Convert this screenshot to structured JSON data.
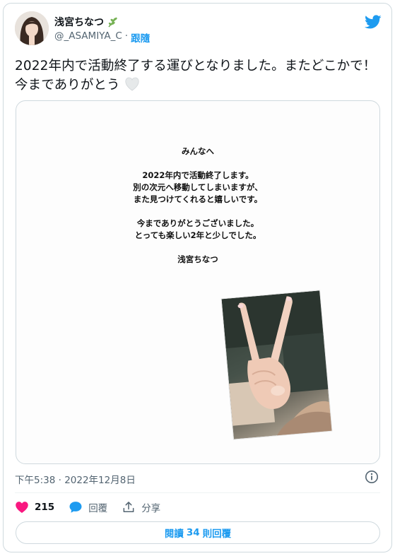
{
  "user": {
    "display_name": "浅宮ちなつ",
    "handle": "@_ASAMIYA_C",
    "separator": "·",
    "follow_label": "跟隨"
  },
  "tweet": {
    "text": "2022年内で活動終了する運びとなりました。またどこかで！今までありがとう",
    "emoji": "heart-icon"
  },
  "letter": {
    "lines": [
      "みんなへ",
      "",
      "2022年内で活動終了します。",
      "別の次元へ移動してしまいますが、",
      "また見つけてくれると嬉しいです。",
      "",
      "今までありがとうございました。",
      "とっても楽しい2年と少しでした。",
      "",
      "浅宮ちなつ"
    ]
  },
  "meta": {
    "timestamp": "下午5:38 · 2022年12月8日"
  },
  "actions": {
    "like_count": "215",
    "reply_label": "回覆",
    "share_label": "分享"
  },
  "replies_button": {
    "label_prefix": "閱讀",
    "count": "34",
    "label_suffix": "則回覆"
  },
  "colors": {
    "accent": "#1d9bf0",
    "like": "#f91880",
    "text": "#0f1419",
    "muted": "#536471",
    "border": "#cfd9de"
  }
}
